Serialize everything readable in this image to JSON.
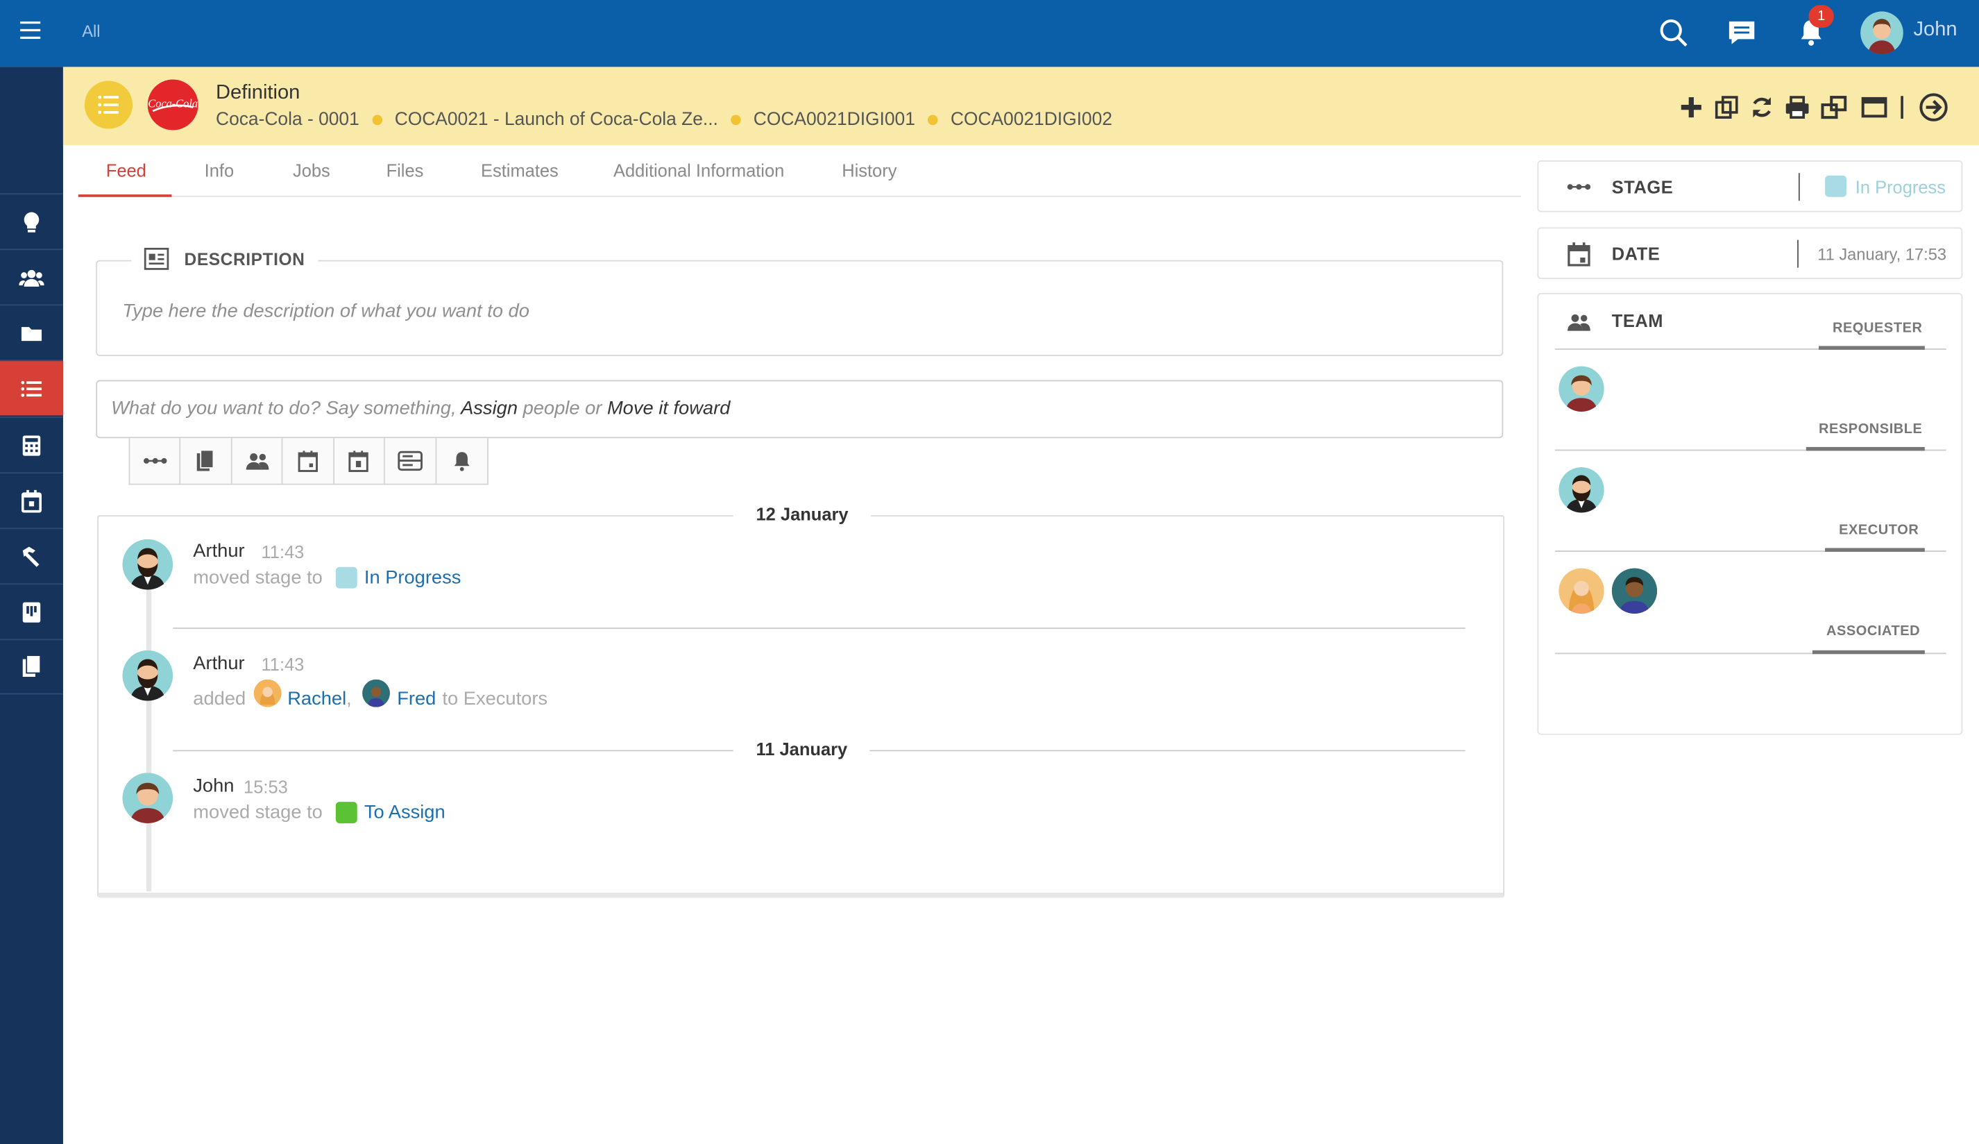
{
  "topbar": {
    "scope_label": "All",
    "notification_count": "1",
    "user_name": "John"
  },
  "header": {
    "title": "Definition",
    "breadcrumbs": [
      "Coca-Cola - 0001",
      "COCA0021 - Launch of Coca-Cola Ze...",
      "COCA0021DIGI001",
      "COCA0021DIGI002"
    ],
    "brand_logo_text": "Coca-Cola"
  },
  "tabs": [
    "Feed",
    "Info",
    "Jobs",
    "Files",
    "Estimates",
    "Additional Information",
    "History"
  ],
  "description": {
    "label": "DESCRIPTION",
    "placeholder": "Type here the description of what you want to do"
  },
  "composer": {
    "p1": "What do you want to do? Say something, ",
    "assign": "Assign",
    "p2": " people or ",
    "move": "Move it foward"
  },
  "feed": {
    "date1": "12 January",
    "date2": "11 January",
    "entries": [
      {
        "user": "Arthur",
        "time": "11:43",
        "action": "moved stage to",
        "target": "In Progress"
      },
      {
        "user": "Arthur",
        "time": "11:43",
        "action": "added",
        "people": [
          "Rachel",
          "Fred"
        ],
        "sep": ",",
        "suffix": "to Executors"
      },
      {
        "user": "John",
        "time": "15:53",
        "action": "moved stage to",
        "target": "To Assign"
      }
    ]
  },
  "panel": {
    "stage_label": "STAGE",
    "stage_value": "In Progress",
    "date_label": "DATE",
    "date_value": "11 January, 17:53",
    "team_label": "TEAM",
    "roles": [
      "REQUESTER",
      "RESPONSIBLE",
      "EXECUTOR",
      "ASSOCIATED"
    ]
  },
  "colors": {
    "topbar": "#0b5ea8",
    "sidebar": "#16345b",
    "active": "#d64036",
    "header": "#faeaaa",
    "in_progress": "#a9dbe4",
    "to_assign": "#5bc236",
    "link": "#1b6fae"
  }
}
